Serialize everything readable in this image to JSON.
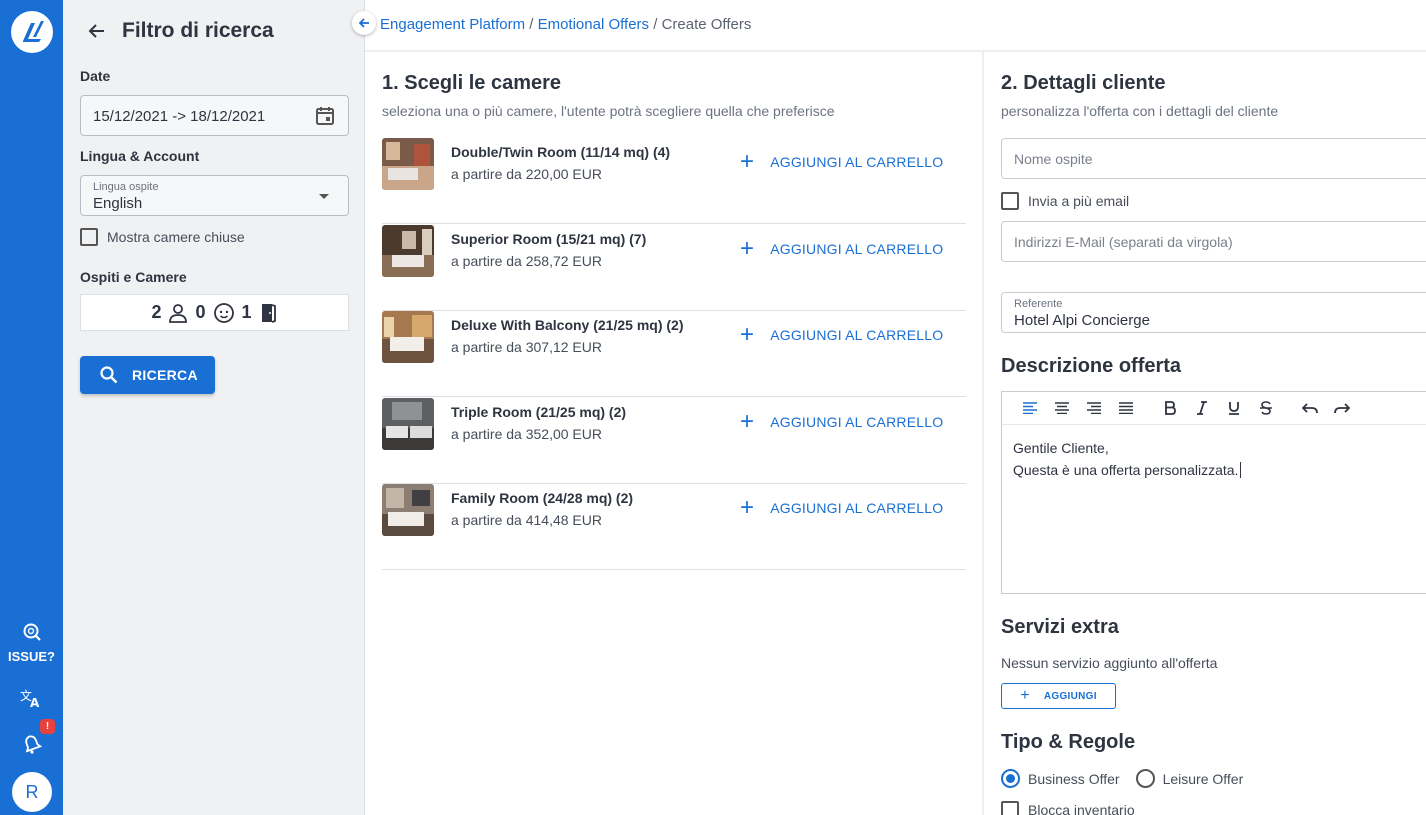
{
  "rail": {
    "issue_label": "ISSUE?",
    "notification_badge": "!",
    "avatar_initial": "R"
  },
  "filter": {
    "title": "Filtro di ricerca",
    "date_label": "Date",
    "date_value": "15/12/2021 -> 18/12/2021",
    "lang_section_label": "Lingua & Account",
    "lang_field_label": "Lingua ospite",
    "lang_value": "English",
    "show_closed_label": "Mostra camere chiuse",
    "guests_label": "Ospiti e Camere",
    "adults": "2",
    "children": "0",
    "rooms": "1",
    "search_label": "RICERCA"
  },
  "breadcrumb": {
    "item1": "Engagement Platform",
    "sep": " / ",
    "item2": "Emotional Offers",
    "item3": "Create Offers"
  },
  "rooms_section": {
    "title": "1. Scegli le camere",
    "subtitle": "seleziona una o più camere, l'utente potrà scegliere quella che preferisce",
    "add_label": "AGGIUNGI AL CARRELLO",
    "items": [
      {
        "name": "Double/Twin Room (11/14 mq) (4)",
        "price": "a partire da 220,00 EUR"
      },
      {
        "name": "Superior Room (15/21 mq) (7)",
        "price": "a partire da 258,72 EUR"
      },
      {
        "name": "Deluxe With Balcony (21/25 mq) (2)",
        "price": "a partire da 307,12 EUR"
      },
      {
        "name": "Triple Room (21/25 mq) (2)",
        "price": "a partire da 352,00 EUR"
      },
      {
        "name": "Family Room (24/28 mq) (2)",
        "price": "a partire da 414,48 EUR"
      }
    ]
  },
  "client_section": {
    "title": "2. Dettagli cliente",
    "subtitle": "personalizza l'offerta con i dettagli del cliente",
    "guest_name_placeholder": "Nome ospite",
    "multi_email_label": "Invia a più email",
    "emails_placeholder": "Indirizzi E-Mail (separati da virgola)",
    "referent_label": "Referente",
    "referent_value": "Hotel Alpi Concierge",
    "description_title": "Descrizione offerta",
    "description_line1": "Gentile Cliente,",
    "description_line2": "Questa è una offerta personalizzata.",
    "extras_title": "Servizi extra",
    "extras_empty": "Nessun servizio aggiunto all'offerta",
    "extras_add": "AGGIUNGI",
    "type_title": "Tipo & Regole",
    "business_label": "Business Offer",
    "leisure_label": "Leisure Offer",
    "block_inventory_label": "Blocca inventario"
  },
  "colors": {
    "primary": "#1a6fd4",
    "panel_bg": "#f0f1f3",
    "badge": "#e8413b"
  }
}
